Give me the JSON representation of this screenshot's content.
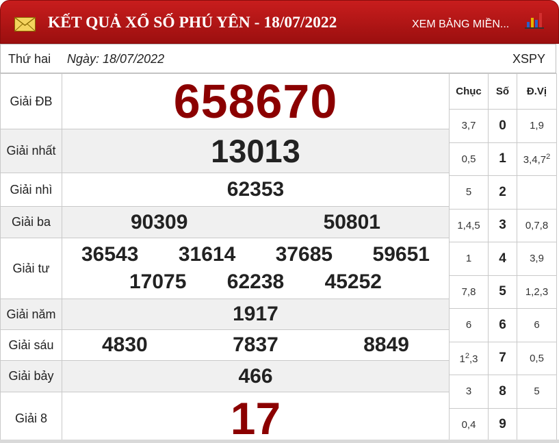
{
  "header": {
    "title": "KẾT QUẢ XỔ SỐ PHÚ YÊN - 18/07/2022",
    "link": "XEM BẢNG MIỀN...",
    "icons": [
      "mail-icon",
      "bar-chart-icon"
    ],
    "colors": {
      "header_bg": "#b51515",
      "number_dark_red": "#8b0000"
    }
  },
  "info": {
    "day": "Thứ hai",
    "date": "Ngày: 18/07/2022",
    "code": "XSPY"
  },
  "prizes": {
    "special": {
      "label": "Giải ĐB",
      "numbers": [
        "658670"
      ]
    },
    "first": {
      "label": "Giải nhất",
      "numbers": [
        "13013"
      ]
    },
    "second": {
      "label": "Giải nhì",
      "numbers": [
        "62353"
      ]
    },
    "third": {
      "label": "Giải ba",
      "numbers": [
        "90309",
        "50801"
      ]
    },
    "fourth": {
      "label": "Giải tư",
      "numbers": [
        "36543",
        "31614",
        "37685",
        "59651",
        "17075",
        "62238",
        "45252"
      ]
    },
    "fifth": {
      "label": "Giải năm",
      "numbers": [
        "1917"
      ]
    },
    "sixth": {
      "label": "Giải sáu",
      "numbers": [
        "4830",
        "7837",
        "8849"
      ]
    },
    "seventh": {
      "label": "Giải bảy",
      "numbers": [
        "466"
      ]
    },
    "eighth": {
      "label": "Giải 8",
      "numbers": [
        "17"
      ]
    }
  },
  "loto": {
    "headers": [
      "Chục",
      "Số",
      "Đ.Vị"
    ],
    "rows": [
      {
        "chuc": "3,7",
        "so": "0",
        "dv": "1,9",
        "chuc_sup": "",
        "dv_sup": ""
      },
      {
        "chuc": "0,5",
        "so": "1",
        "dv": "3,4,7",
        "chuc_sup": "",
        "dv_sup": "2"
      },
      {
        "chuc": "5",
        "so": "2",
        "dv": "",
        "chuc_sup": "",
        "dv_sup": ""
      },
      {
        "chuc": "1,4,5",
        "so": "3",
        "dv": "0,7,8",
        "chuc_sup": "",
        "dv_sup": ""
      },
      {
        "chuc": "1",
        "so": "4",
        "dv": "3,9",
        "chuc_sup": "",
        "dv_sup": ""
      },
      {
        "chuc": "7,8",
        "so": "5",
        "dv": "1,2,3",
        "chuc_sup": "",
        "dv_sup": ""
      },
      {
        "chuc": "6",
        "so": "6",
        "dv": "6",
        "chuc_sup": "",
        "dv_sup": ""
      },
      {
        "chuc": "1",
        "so": "7",
        "dv": "0,5",
        "chuc_sup": "2",
        "chuc_tail": ",3",
        "dv_sup": ""
      },
      {
        "chuc": "3",
        "so": "8",
        "dv": "5",
        "chuc_sup": "",
        "dv_sup": ""
      },
      {
        "chuc": "0,4",
        "so": "9",
        "dv": "",
        "chuc_sup": "",
        "dv_sup": ""
      }
    ]
  }
}
